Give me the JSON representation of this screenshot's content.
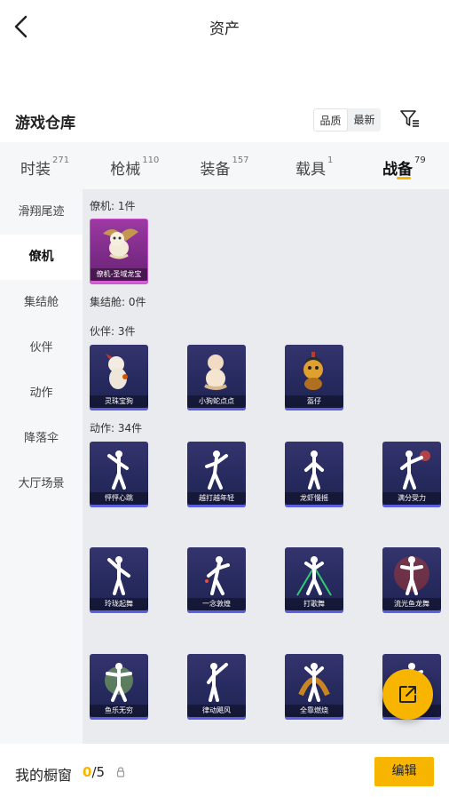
{
  "header": {
    "title": "资产",
    "back_icon": "chevron-left-icon"
  },
  "warehouse": {
    "title": "游戏仓库",
    "sort_options": [
      "品质",
      "最新"
    ],
    "filter_icon": "filter-icon"
  },
  "tabs": [
    {
      "label": "时装",
      "count": "271"
    },
    {
      "label": "枪械",
      "count": "110"
    },
    {
      "label": "装备",
      "count": "157"
    },
    {
      "label": "载具",
      "count": "1"
    },
    {
      "label": "战备",
      "count": "79",
      "active": true
    }
  ],
  "sidebar": {
    "items": [
      "滑翔尾迹",
      "僚机",
      "集结舱",
      "伙伴",
      "动作",
      "降落伞",
      "大厅场景"
    ],
    "active_index": 1
  },
  "groups": {
    "wingman": {
      "label": "僚机: 1件",
      "items": [
        "僚机-圣域龙宝"
      ]
    },
    "pod": {
      "label": "集结舱: 0件"
    },
    "partner": {
      "label": "伙伴: 3件",
      "items": [
        "灵珠宝狗",
        "小狗蛇点点",
        "盔仔"
      ]
    },
    "emote": {
      "label": "动作: 34件",
      "items": [
        "怦怦心跳",
        "越打越年轻",
        "龙虾慢摇",
        "满分受力",
        "玲珑起舞",
        "一念敦煌",
        "打歌舞",
        "流光鱼龙舞",
        "鱼乐无穷",
        "律动飓风",
        "全靠燃烧",
        ""
      ]
    }
  },
  "fab_icon": "share-external-icon",
  "bottom": {
    "label": "我的橱窗",
    "count_current": "0",
    "count_total": "/5",
    "lock_icon": "lock-icon",
    "edit_label": "编辑"
  },
  "colors": {
    "accent": "#f7b500",
    "card_blue": "#262a5e",
    "card_pink": "#7b2a86"
  }
}
